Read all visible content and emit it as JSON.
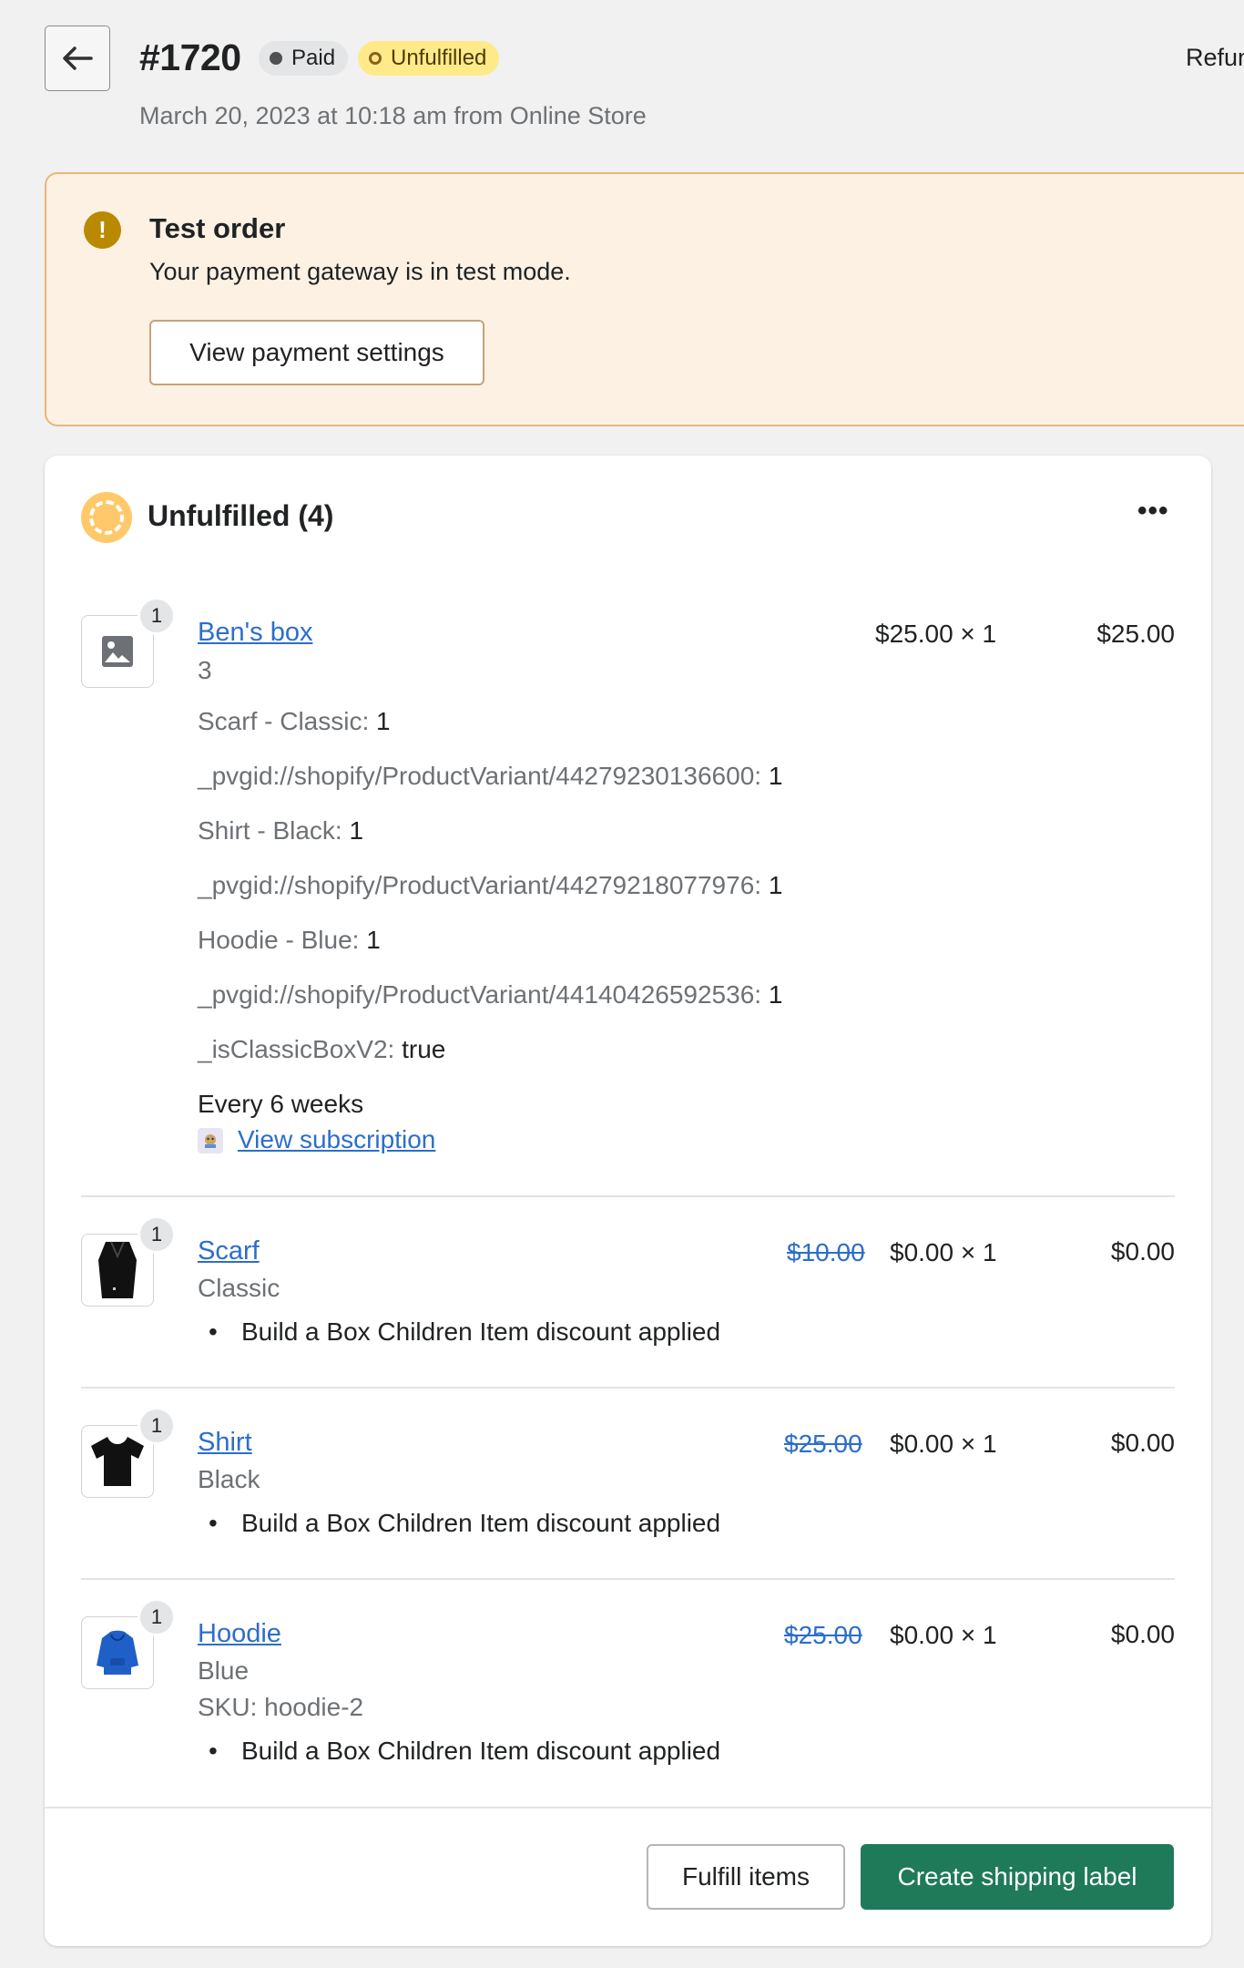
{
  "header": {
    "order_number": "#1720",
    "badge_paid": "Paid",
    "badge_unfulfilled": "Unfulfilled",
    "refund_label": "Refund",
    "subtitle": "March 20, 2023 at 10:18 am from Online Store"
  },
  "banner": {
    "title": "Test order",
    "text": "Your payment gateway is in test mode.",
    "button": "View payment settings",
    "icon": "alert-circle-icon"
  },
  "card": {
    "title": "Unfulfilled (4)",
    "more": "•••",
    "items": [
      {
        "name": "Ben's box",
        "quantity_badge": "1",
        "variant": "3",
        "properties": [
          {
            "key": "Scarf - Classic:",
            "value": "1"
          },
          {
            "key": "_pvgid://shopify/ProductVariant/44279230136600:",
            "value": "1"
          },
          {
            "key": "Shirt - Black:",
            "value": "1"
          },
          {
            "key": "_pvgid://shopify/ProductVariant/44279218077976:",
            "value": "1"
          },
          {
            "key": "Hoodie - Blue:",
            "value": "1"
          },
          {
            "key": "_pvgid://shopify/ProductVariant/44140426592536:",
            "value": "1"
          },
          {
            "key": "_isClassicBoxV2:",
            "value": "true"
          }
        ],
        "frequency": "Every 6 weeks",
        "subscription_link": "View subscription",
        "unit_price": "$25.00 × 1",
        "total": "$25.00",
        "thumb_icon": "image-placeholder-icon"
      },
      {
        "name": "Scarf",
        "quantity_badge": "1",
        "variant": "Classic",
        "original_price": "$10.00",
        "unit_price": "$0.00 × 1",
        "total": "$0.00",
        "discount": "Build a Box Children Item discount applied",
        "thumb_icon": "scarf-icon"
      },
      {
        "name": "Shirt",
        "quantity_badge": "1",
        "variant": "Black",
        "original_price": "$25.00",
        "unit_price": "$0.00 × 1",
        "total": "$0.00",
        "discount": "Build a Box Children Item discount applied",
        "thumb_icon": "tshirt-icon"
      },
      {
        "name": "Hoodie",
        "quantity_badge": "1",
        "variant": "Blue",
        "sku": "SKU: hoodie-2",
        "original_price": "$25.00",
        "unit_price": "$0.00 × 1",
        "total": "$0.00",
        "discount": "Build a Box Children Item discount applied",
        "thumb_icon": "hoodie-icon"
      }
    ],
    "fulfill_button": "Fulfill items",
    "shipping_button": "Create shipping label"
  },
  "colors": {
    "primary_button": "#1f7a5a",
    "link": "#2c6ecb",
    "banner_bg": "#fdf1e4",
    "warning_icon": "#b98900",
    "unfulfilled_badge": "#ffea8a"
  }
}
